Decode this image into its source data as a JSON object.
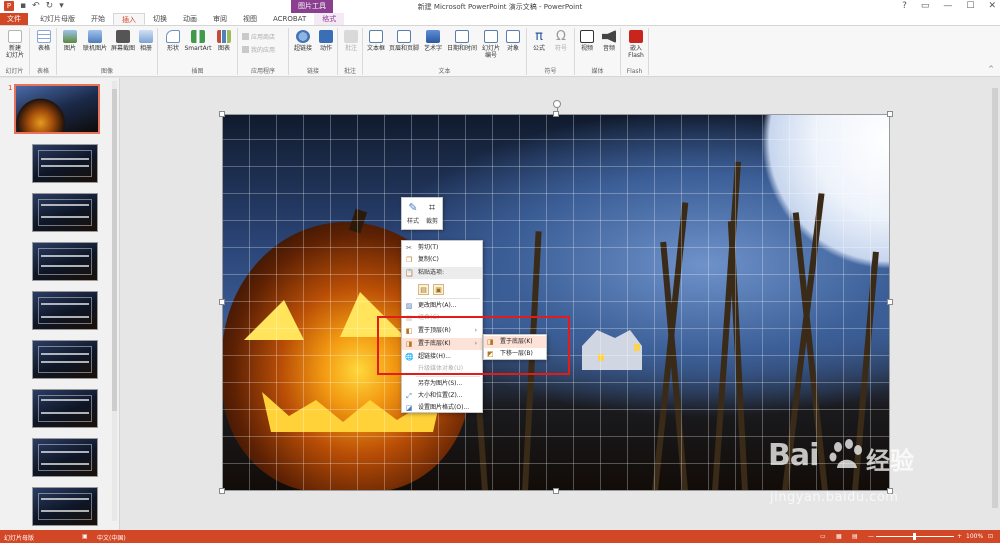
{
  "window": {
    "title": "新建 Microsoft PowerPoint 演示文稿 - PowerPoint",
    "contextual_header": "图片工具",
    "controls": [
      "?",
      "▭",
      "—",
      "☐",
      "✕"
    ]
  },
  "quick_access": {
    "save": "💾",
    "undo": "↶",
    "redo": "↻"
  },
  "tabs": [
    {
      "label": "文件"
    },
    {
      "label": "幻灯片母版"
    },
    {
      "label": "开始"
    },
    {
      "label": "插入"
    },
    {
      "label": "切换"
    },
    {
      "label": "动画"
    },
    {
      "label": "审阅"
    },
    {
      "label": "视图"
    },
    {
      "label": "ACROBAT"
    },
    {
      "label": "格式"
    }
  ],
  "ribbon": {
    "groups": {
      "slides": "幻灯片",
      "tables": "表格",
      "images": "图像",
      "illustrations": "插图",
      "apps": "应用程序",
      "links": "链接",
      "comments": "批注",
      "text": "文本",
      "symbols": "符号",
      "media": "媒体",
      "flash": "Flash"
    },
    "buttons": {
      "new_slide": "新建\n幻灯片",
      "table": "表格",
      "picture": "图片",
      "online_picture": "联机图片",
      "screenshot": "屏幕截图",
      "album": "相册",
      "shapes": "形状",
      "smartart": "SmartArt",
      "chart": "图表",
      "app_store": "应用商店",
      "my_apps": "我的应用",
      "hyperlink": "超链接",
      "action": "动作",
      "comment": "批注",
      "textbox": "文本框",
      "header_footer": "页眉和页脚",
      "wordart": "艺术字",
      "datetime": "日期和时间",
      "slide_number": "幻灯片\n编号",
      "object": "对象",
      "equation": "公式",
      "symbol": "符号",
      "video": "视频",
      "audio": "音频",
      "embed_flash": "嵌入\nFlash"
    }
  },
  "thumbnails": {
    "current_index": "1"
  },
  "mini_toolbar": {
    "style": "样式",
    "crop": "裁剪"
  },
  "context_menu": {
    "cut": "剪切(T)",
    "copy": "复制(C)",
    "paste_options": "粘贴选项:",
    "change_picture": "更改图片(A)...",
    "group": "组合(G)",
    "bring_to_front": "置于顶层(R)",
    "send_to_back": "置于底层(K)",
    "hyperlink": "超链接(H)...",
    "promote": "升级媒体对象(U)",
    "save_as_picture": "另存为图片(S)...",
    "size_position": "大小和位置(Z)...",
    "format_picture": "设置图片格式(O)..."
  },
  "submenu": {
    "send_to_back": "置于底层(K)",
    "send_backward": "下移一层(B)"
  },
  "watermark": {
    "logo": "Bai",
    "logo_cn": "经验",
    "url": "jingyan.baidu.com"
  },
  "status": {
    "mode": "幻灯片母版",
    "language": "中文(中国)",
    "zoom": "100%",
    "zoom_minus": "—",
    "zoom_plus": "+"
  },
  "colors": {
    "accent": "#d24726",
    "picture_tools": "#8a3f8f",
    "highlight_box": "#e21b1b"
  }
}
